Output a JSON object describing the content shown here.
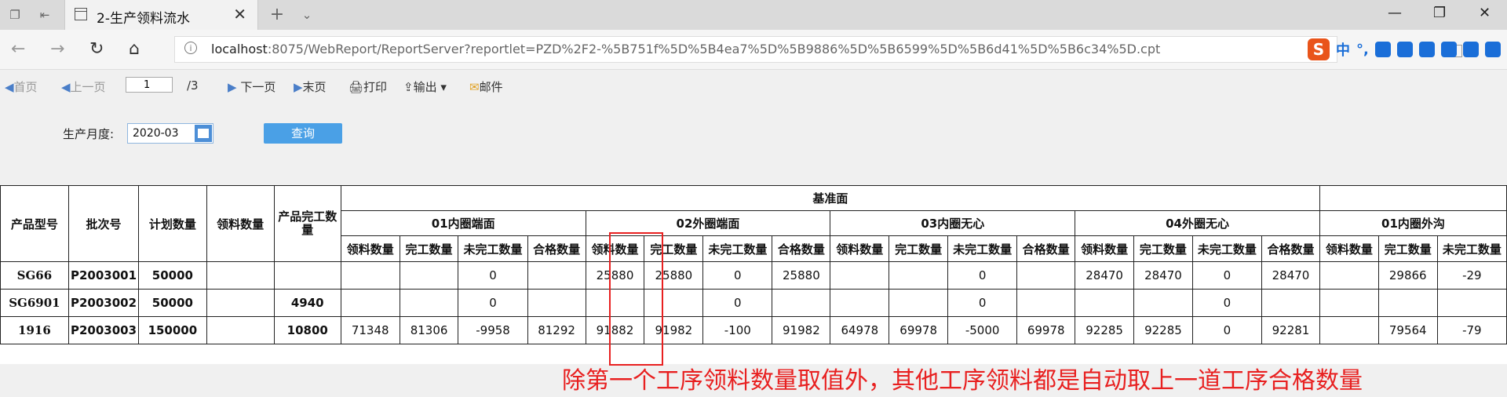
{
  "browser": {
    "tab_title": "2-生产领料流水",
    "url_host": "localhost",
    "url_rest": ":8075/WebReport/ReportServer?reportlet=PZD%2F2-%5B751f%5D%5B4ea7%5D%5B9886%5D%5B6599%5D%5B6d41%5D%5B6c34%5D.cpt",
    "ime_zh": "中",
    "ime_punct": "°,"
  },
  "toolbar": {
    "first": "首页",
    "prev": "上一页",
    "page_value": "1",
    "page_total": "/3",
    "next": "下一页",
    "last": "末页",
    "print": "打印",
    "export": "输出",
    "mail": "邮件"
  },
  "filter": {
    "label": "生产月度:",
    "month": "2020-03",
    "query": "查询"
  },
  "table": {
    "fixed_headers": [
      "产品型号",
      "批次号",
      "计划数量",
      "领料数量",
      "产品完工数量"
    ],
    "group": "基准面",
    "processes": [
      "01内圈端面",
      "02外圈端面",
      "03内圈无心",
      "04外圈无心",
      "01内圈外沟"
    ],
    "sub_headers": [
      "领料数量",
      "完工数量",
      "未完工数量",
      "合格数量"
    ],
    "rows": [
      {
        "model": "SG66",
        "batch": "P2003001",
        "plan": "50000",
        "pick": "",
        "done": "",
        "cells": [
          "",
          "",
          "0",
          "",
          "25880",
          "25880",
          "0",
          "25880",
          "",
          "",
          "0",
          "",
          "28470",
          "28470",
          "0",
          "28470",
          "",
          "29866",
          "-29"
        ]
      },
      {
        "model": "SG6901",
        "batch": "P2003002",
        "plan": "50000",
        "pick": "",
        "done": "4940",
        "cells": [
          "",
          "",
          "0",
          "",
          "",
          "",
          "0",
          "",
          "",
          "",
          "0",
          "",
          "",
          "",
          "0",
          "",
          "",
          "",
          ""
        ]
      },
      {
        "model": "1916",
        "batch": "P2003003",
        "plan": "150000",
        "pick": "",
        "done": "10800",
        "cells": [
          "71348",
          "81306",
          "-9958",
          "81292",
          "91882",
          "91982",
          "-100",
          "91982",
          "64978",
          "69978",
          "-5000",
          "69978",
          "92285",
          "92285",
          "0",
          "92281",
          "",
          "79564",
          "-79"
        ]
      }
    ]
  },
  "annotation": "除第一个工序领料数量取值外，其他工序领料都是自动取上一道工序合格数量",
  "colors": {
    "accent": "#4aa0e6",
    "annotation": "#e82020"
  }
}
